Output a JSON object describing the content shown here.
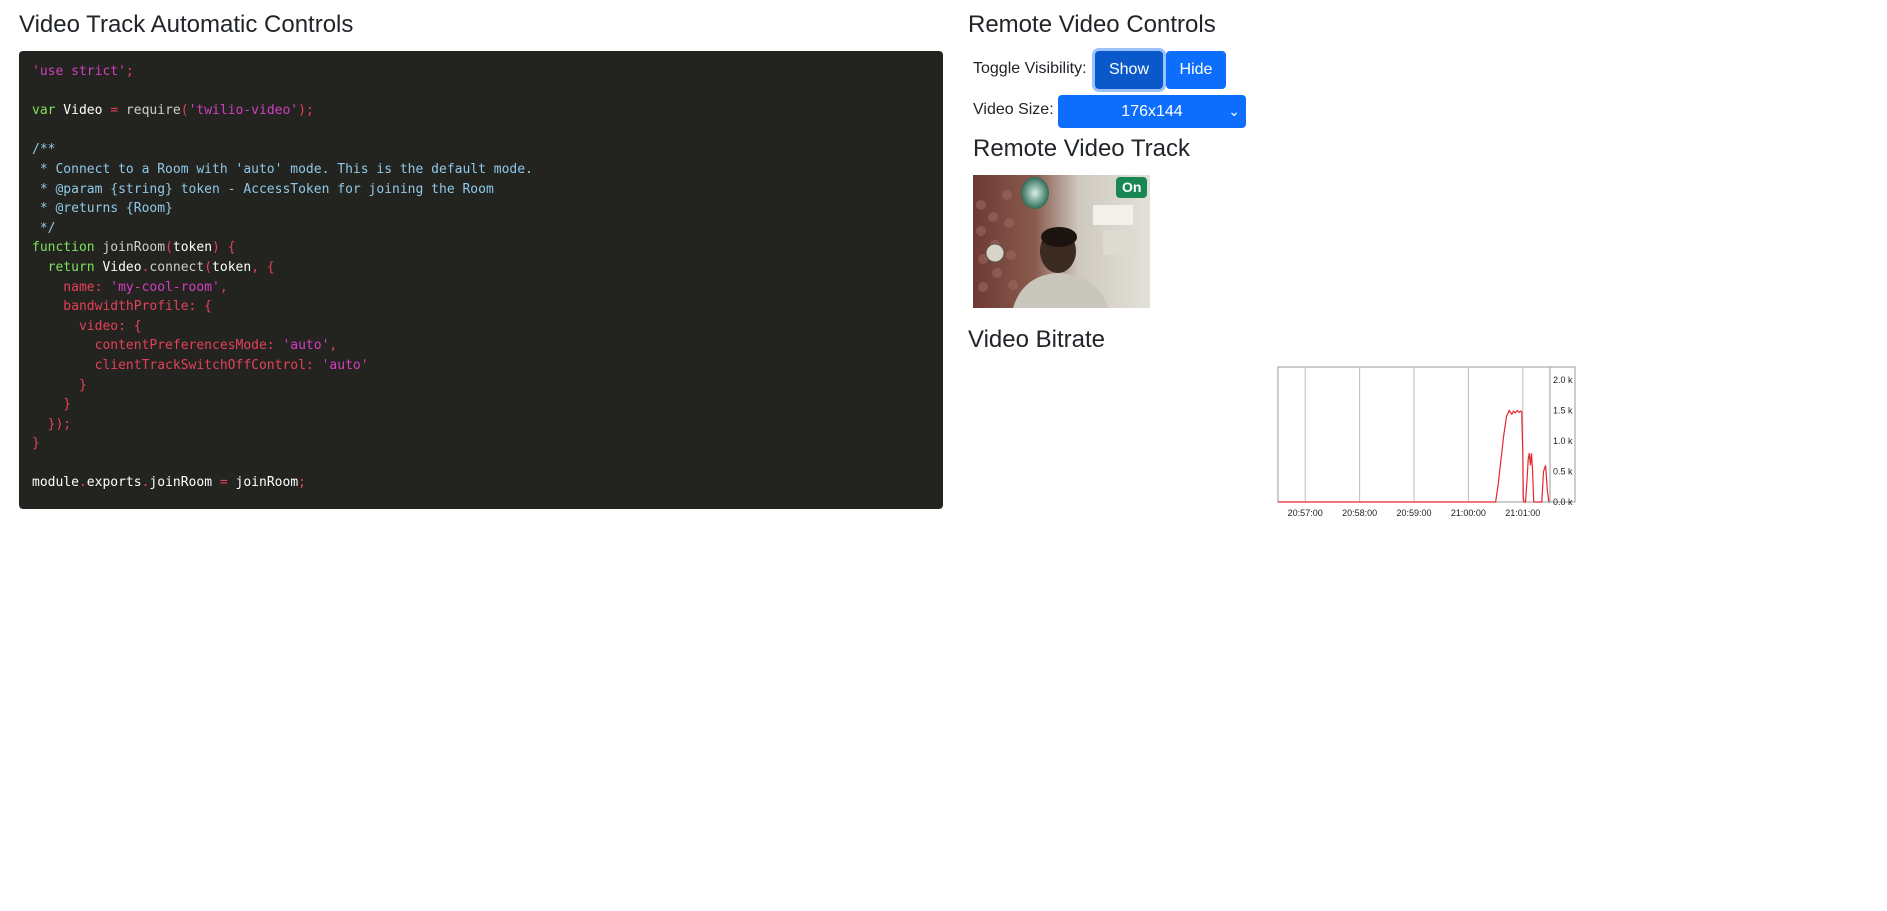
{
  "left": {
    "title": "Video Track Automatic Controls",
    "code_lines": [
      [
        {
          "t": "'use strict'",
          "c": "t-mag"
        },
        {
          "t": ";",
          "c": "t-red"
        }
      ],
      [],
      [
        {
          "t": "var",
          "c": "t-keyword"
        },
        {
          "t": " Video ",
          "c": "t-white"
        },
        {
          "t": "=",
          "c": "t-red"
        },
        {
          "t": " require",
          "c": "t-grey"
        },
        {
          "t": "(",
          "c": "t-red"
        },
        {
          "t": "'twilio-video'",
          "c": "t-mag"
        },
        {
          "t": ");",
          "c": "t-red"
        }
      ],
      [],
      [
        {
          "t": "/**",
          "c": "t-comment"
        }
      ],
      [
        {
          "t": " * Connect to a Room with 'auto' mode. This is the default mode.",
          "c": "t-comment"
        }
      ],
      [
        {
          "t": " * @param {string} token - AccessToken for joining the Room",
          "c": "t-comment"
        }
      ],
      [
        {
          "t": " * @returns {Room}",
          "c": "t-comment"
        }
      ],
      [
        {
          "t": " */",
          "c": "t-comment"
        }
      ],
      [
        {
          "t": "function",
          "c": "t-keyword"
        },
        {
          "t": " joinRoom",
          "c": "t-grey"
        },
        {
          "t": "(",
          "c": "t-red"
        },
        {
          "t": "token",
          "c": "t-white"
        },
        {
          "t": ") {",
          "c": "t-red"
        }
      ],
      [
        {
          "t": "  return",
          "c": "t-keyword"
        },
        {
          "t": " Video",
          "c": "t-white"
        },
        {
          "t": ".",
          "c": "t-red"
        },
        {
          "t": "connect",
          "c": "t-grey"
        },
        {
          "t": "(",
          "c": "t-red"
        },
        {
          "t": "token",
          "c": "t-white"
        },
        {
          "t": ", {",
          "c": "t-red"
        }
      ],
      [
        {
          "t": "    name: ",
          "c": "t-red"
        },
        {
          "t": "'my-cool-room'",
          "c": "t-mag"
        },
        {
          "t": ",",
          "c": "t-red"
        }
      ],
      [
        {
          "t": "    bandwidthProfile: {",
          "c": "t-red"
        }
      ],
      [
        {
          "t": "      video: {",
          "c": "t-red"
        }
      ],
      [
        {
          "t": "        contentPreferencesMode: ",
          "c": "t-red"
        },
        {
          "t": "'auto'",
          "c": "t-mag"
        },
        {
          "t": ",",
          "c": "t-red"
        }
      ],
      [
        {
          "t": "        clientTrackSwitchOffControl: ",
          "c": "t-red"
        },
        {
          "t": "'auto'",
          "c": "t-mag"
        }
      ],
      [
        {
          "t": "      }",
          "c": "t-red"
        }
      ],
      [
        {
          "t": "    }",
          "c": "t-red"
        }
      ],
      [
        {
          "t": "  });",
          "c": "t-red"
        }
      ],
      [
        {
          "t": "}",
          "c": "t-red"
        }
      ],
      [],
      [
        {
          "t": "module",
          "c": "t-white"
        },
        {
          "t": ".",
          "c": "t-red"
        },
        {
          "t": "exports",
          "c": "t-white"
        },
        {
          "t": ".",
          "c": "t-red"
        },
        {
          "t": "joinRoom",
          "c": "t-white"
        },
        {
          "t": " = ",
          "c": "t-red"
        },
        {
          "t": "joinRoom",
          "c": "t-white"
        },
        {
          "t": ";",
          "c": "t-red"
        }
      ]
    ]
  },
  "right": {
    "title": "Remote Video Controls",
    "toggle_label": "Toggle Visibility:",
    "show_label": "Show",
    "hide_label": "Hide",
    "size_label": "Video Size:",
    "size_value": "176x144",
    "track_title": "Remote Video Track",
    "track_badge": "On",
    "bitrate_title": "Video Bitrate"
  },
  "colors": {
    "code_bg": "#23241f",
    "primary": "#0d6efd",
    "badge": "#198754",
    "chart_line": "#e8262d"
  },
  "chart_data": {
    "type": "line",
    "title": "",
    "xlabel": "",
    "ylabel": "",
    "x_tick_labels": [
      "20:57:00",
      "20:58:00",
      "20:59:00",
      "21:00:00",
      "21:01:00"
    ],
    "y_tick_labels": [
      "0.0 k",
      "0.5 k",
      "1.0 k",
      "1.5 k",
      "2.0 k"
    ],
    "y_ticks": [
      0,
      0.5,
      1.0,
      1.5,
      2.0
    ],
    "ylim": [
      0,
      2.0
    ],
    "x_minutes_range": [
      -0.5,
      4.5
    ],
    "grid": "vertical",
    "series": [
      {
        "x": [
          -0.5,
          3.5,
          3.55,
          3.6,
          3.65,
          3.7,
          3.75,
          3.8,
          3.83,
          3.86,
          3.9,
          3.93,
          3.96,
          3.98,
          4.0,
          4.01,
          4.02,
          4.05,
          4.08,
          4.1,
          4.12,
          4.14,
          4.16,
          4.18,
          4.2,
          4.22,
          4.25,
          4.3,
          4.35,
          4.38,
          4.42,
          4.45,
          4.48
        ],
        "y": [
          0,
          0,
          0.3,
          0.7,
          1.1,
          1.4,
          1.5,
          1.44,
          1.49,
          1.46,
          1.5,
          1.47,
          1.49,
          1.48,
          0.8,
          0.1,
          0,
          0,
          0.4,
          0.7,
          0.8,
          0.6,
          0.8,
          0.5,
          0,
          0,
          0,
          0,
          0,
          0.5,
          0.6,
          0.2,
          0
        ]
      }
    ]
  }
}
